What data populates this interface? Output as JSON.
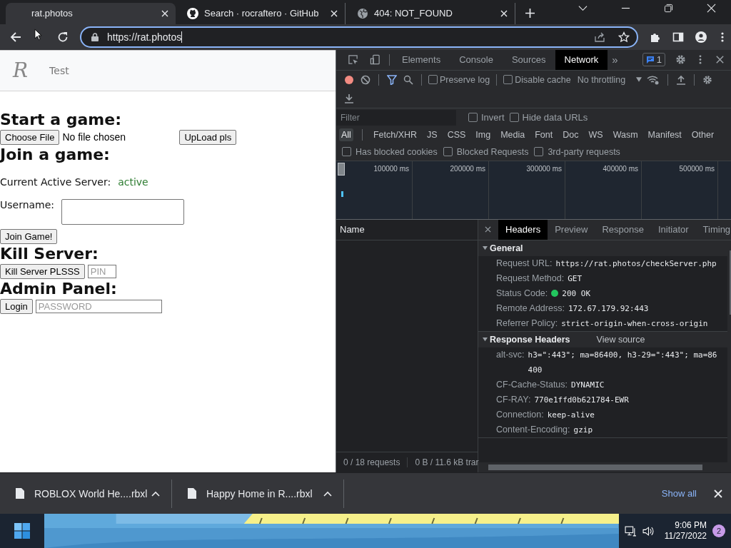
{
  "browser": {
    "tabs": [
      {
        "kind": "blank",
        "title": "rat.photos",
        "selected": true
      },
      {
        "kind": "github",
        "title": "Search · rocraftero · GitHub",
        "selected": false
      },
      {
        "kind": "globe",
        "title": "404: NOT_FOUND",
        "selected": false
      }
    ],
    "address": "https://rat.photos"
  },
  "page": {
    "nav": {
      "logo": "R",
      "link": "Test"
    },
    "start": {
      "heading": "Start a game:",
      "file_button": "Choose File",
      "file_status": "No file chosen",
      "upload_button": "UpLoad pls"
    },
    "join": {
      "heading": "Join a game:",
      "server_label": "Current Active Server:",
      "server_status": "active",
      "username_label": "Username:",
      "join_button": "Join Game!"
    },
    "kill": {
      "heading": "Kill Server:",
      "button": "Kill Server PLSSS",
      "placeholder": "PIN"
    },
    "admin": {
      "heading": "Admin Panel:",
      "button": "Login",
      "placeholder": "PASSWORD"
    }
  },
  "devtools": {
    "tabs": [
      {
        "label": "Elements",
        "selected": false
      },
      {
        "label": "Console",
        "selected": false
      },
      {
        "label": "Sources",
        "selected": false
      },
      {
        "label": "Network",
        "selected": true
      }
    ],
    "more": "»",
    "issues_count": "1",
    "toolbar": {
      "recording": true,
      "options": [
        {
          "label": "Preserve log",
          "checked": false
        },
        {
          "label": "Disable cache",
          "checked": false
        }
      ],
      "throttling": "No throttling"
    },
    "filter": {
      "placeholder": "Filter",
      "options": [
        {
          "label": "Invert",
          "checked": false
        },
        {
          "label": "Hide data URLs",
          "checked": false
        }
      ]
    },
    "types": [
      {
        "label": "All",
        "selected": true
      },
      {
        "label": "Fetch/XHR",
        "selected": false
      },
      {
        "label": "JS",
        "selected": false
      },
      {
        "label": "CSS",
        "selected": false
      },
      {
        "label": "Img",
        "selected": false
      },
      {
        "label": "Media",
        "selected": false
      },
      {
        "label": "Font",
        "selected": false
      },
      {
        "label": "Doc",
        "selected": false
      },
      {
        "label": "WS",
        "selected": false
      },
      {
        "label": "Wasm",
        "selected": false
      },
      {
        "label": "Manifest",
        "selected": false
      },
      {
        "label": "Other",
        "selected": false
      }
    ],
    "blocked_filters": [
      {
        "label": "Has blocked cookies",
        "checked": false
      },
      {
        "label": "Blocked Requests",
        "checked": false
      },
      {
        "label": "3rd-party requests",
        "checked": false
      }
    ],
    "timeline_ticks": [
      "100000 ms",
      "200000 ms",
      "300000 ms",
      "400000 ms",
      "500000 ms"
    ],
    "requests": {
      "column": "Name",
      "summary": "0 / 18 requests",
      "transfer": "0 B / 11.6 kB trar"
    },
    "details": {
      "tabs": [
        {
          "label": "Headers",
          "selected": true
        },
        {
          "label": "Preview",
          "selected": false
        },
        {
          "label": "Response",
          "selected": false
        },
        {
          "label": "Initiator",
          "selected": false
        },
        {
          "label": "Timing",
          "selected": false
        }
      ],
      "sections": [
        {
          "title": "General",
          "expanded": true,
          "rows": [
            {
              "kind": "text",
              "name": "Request URL:",
              "value": "https://rat.photos/checkServer.php"
            },
            {
              "kind": "text",
              "name": "Request Method:",
              "value": "GET"
            },
            {
              "kind": "status",
              "name": "Status Code:",
              "value": "200 OK"
            },
            {
              "kind": "text",
              "name": "Remote Address:",
              "value": "172.67.179.92:443"
            },
            {
              "kind": "text",
              "name": "Referrer Policy:",
              "value": "strict-origin-when-cross-origin"
            }
          ]
        },
        {
          "title": "Response Headers",
          "expanded": true,
          "link": "View source",
          "rows": [
            {
              "kind": "text",
              "name": "alt-svc:",
              "value": "h3=\":443\"; ma=86400, h3-29=\":443\"; ma=86400"
            },
            {
              "kind": "text",
              "name": "CF-Cache-Status:",
              "value": "DYNAMIC"
            },
            {
              "kind": "text",
              "name": "CF-RAY:",
              "value": "770e1ffd0b621784-EWR"
            },
            {
              "kind": "text",
              "name": "Connection:",
              "value": "keep-alive"
            },
            {
              "kind": "text",
              "name": "Content-Encoding:",
              "value": "gzip"
            }
          ]
        }
      ]
    }
  },
  "downloads": {
    "items": [
      {
        "name": "ROBLOX World He....rbxl"
      },
      {
        "name": "Happy Home in R....rbxl"
      }
    ],
    "show_all": "Show all"
  },
  "taskbar": {
    "time": "9:06 PM",
    "date": "11/27/2022",
    "notifications": "2"
  }
}
